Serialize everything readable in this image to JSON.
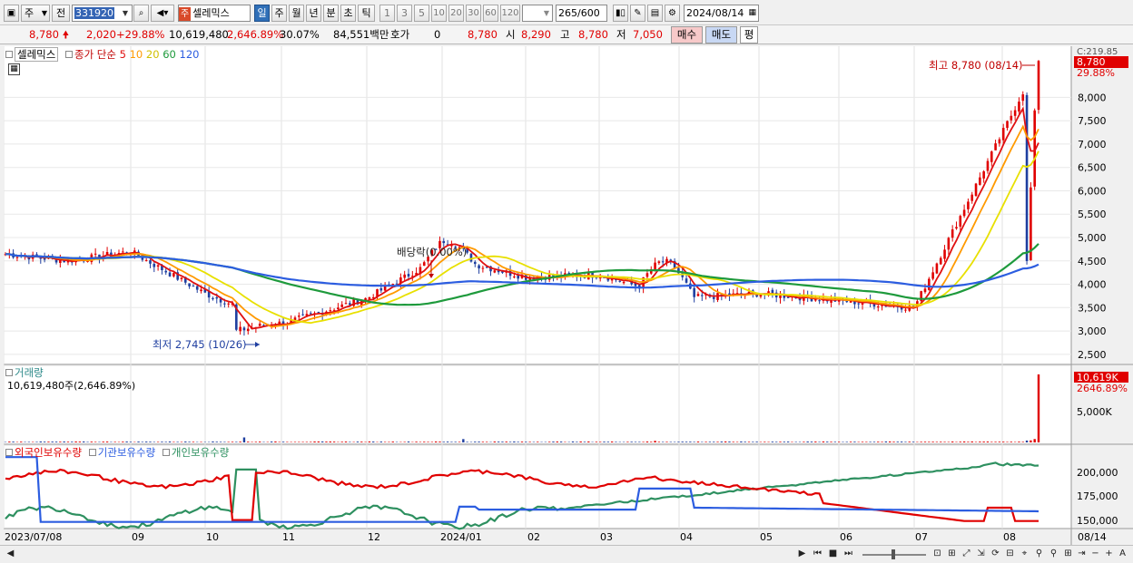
{
  "toolbar": {
    "market": "주",
    "prefix": "전",
    "code": "331920",
    "stock_name": "셀레믹스",
    "periods": [
      "일",
      "주",
      "월",
      "년",
      "분",
      "초",
      "틱"
    ],
    "selected_period": "일",
    "intervals": [
      "1",
      "3",
      "5",
      "10",
      "20",
      "30",
      "60",
      "120"
    ],
    "count": "265",
    "max_count": "/600",
    "date": "2024/08/14"
  },
  "quote": {
    "price": "8,780",
    "change": "2,020",
    "change_pct": "+29.88%",
    "volume": "10,619,480",
    "volume_pct": "2,646.89%",
    "turnover": "30.07%",
    "amount": "84,551백만",
    "hoga_label": "호가",
    "hoga": "0",
    "cur": "8,780",
    "open_label": "시",
    "open": "8,290",
    "high_label": "고",
    "high": "8,780",
    "low_label": "저",
    "low": "7,050",
    "buy_label": "매수",
    "sell_label": "매도",
    "avg_label": "평"
  },
  "price_pane": {
    "stock_tag": "셀레믹스",
    "ma_title": "종가 단순",
    "ma_periods": [
      "5",
      "10",
      "20",
      "60",
      "120"
    ],
    "ma_colors": [
      "#e01010",
      "#ff9a00",
      "#e8e000",
      "#1e9a3c",
      "#2c5de0"
    ],
    "y_ticks": [
      "8,000",
      "7,500",
      "7,000",
      "6,500",
      "6,000",
      "5,500",
      "5,000",
      "4,500",
      "4,000",
      "3,500",
      "3,000",
      "2,500"
    ],
    "last_price_tag": "8,780",
    "last_pct_tag": "29.88%",
    "top_right_label": "C:219.85",
    "max_label": "최고 8,780 (08/14)",
    "min_label": "최저 2,745 (10/26)",
    "dividend_label": "배당락(0.00%)"
  },
  "volume_pane": {
    "title": "거래량",
    "value_text": "10,619,480주(2,646.89%)",
    "tag": "10,619K",
    "tag_pct": "2646.89%",
    "y_tick": "5,000K"
  },
  "holdings_pane": {
    "labels": [
      "외국인보유수량",
      "기관보유수량",
      "개인보유수량"
    ],
    "colors": [
      "#e00000",
      "#2c5de0",
      "#2e9060"
    ],
    "y_ticks": [
      "200,000",
      "175,000",
      "150,000"
    ]
  },
  "x_axis": {
    "labels": [
      "2023/07/08",
      "09",
      "10",
      "11",
      "12",
      "2024/01",
      "02",
      "03",
      "04",
      "05",
      "06",
      "07",
      "08",
      "08/14"
    ]
  },
  "chart_data": {
    "type": "candlestick",
    "title": "셀레믹스 (331920)",
    "ylim": [
      2500,
      8780
    ],
    "dates": [
      "2023-07",
      "2023-08",
      "2023-09",
      "2023-10",
      "2023-11",
      "2023-12",
      "2024-01",
      "2024-02",
      "2024-03",
      "2024-04",
      "2024-05",
      "2024-06",
      "2024-07",
      "2024-08-14"
    ],
    "close": [
      4650,
      4500,
      4700,
      3800,
      3150,
      3700,
      4600,
      4150,
      4200,
      3700,
      3800,
      3650,
      3500,
      8780
    ],
    "high_marker": {
      "date": "2024-08-14",
      "value": 8780
    },
    "low_marker": {
      "date": "2023-10-26",
      "value": 2745
    },
    "volume_latest": 10619480
  }
}
